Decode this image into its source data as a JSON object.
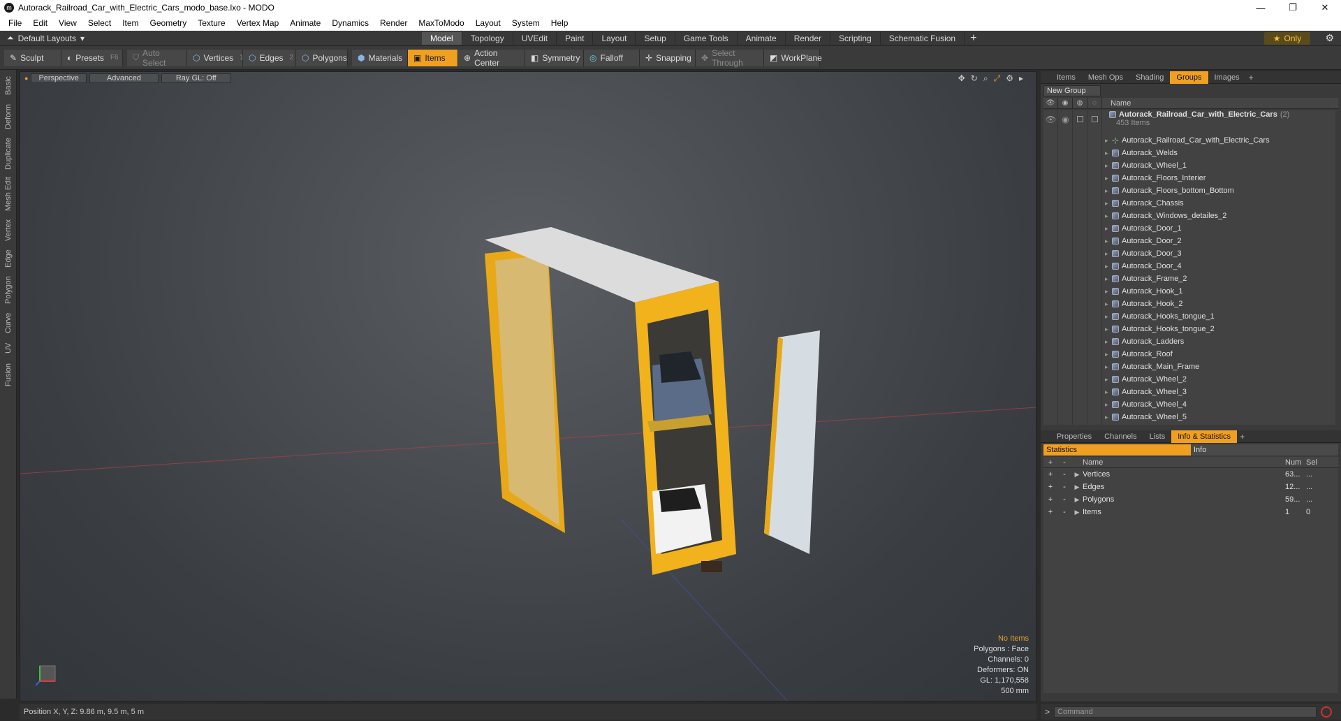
{
  "window": {
    "title": "Autorack_Railroad_Car_with_Electric_Cars_modo_base.lxo - MODO"
  },
  "menu": [
    "File",
    "Edit",
    "View",
    "Select",
    "Item",
    "Geometry",
    "Texture",
    "Vertex Map",
    "Animate",
    "Dynamics",
    "Render",
    "MaxToModo",
    "Layout",
    "System",
    "Help"
  ],
  "layout": {
    "preset": "Default Layouts",
    "tabs": [
      "Model",
      "Topology",
      "UVEdit",
      "Paint",
      "Layout",
      "Setup",
      "Game Tools",
      "Animate",
      "Render",
      "Scripting",
      "Schematic Fusion"
    ],
    "active_tab": "Model",
    "only_label": "Only"
  },
  "toolbar": {
    "sculpt": "Sculpt",
    "presets": "Presets",
    "presets_key": "F6",
    "auto_select": "Auto Select",
    "vertices": "Vertices",
    "vertices_num": "1",
    "edges": "Edges",
    "edges_num": "2",
    "polygons": "Polygons",
    "materials": "Materials",
    "items": "Items",
    "action_center": "Action Center",
    "symmetry": "Symmetry",
    "falloff": "Falloff",
    "snapping": "Snapping",
    "select_through": "Select Through",
    "workplane": "WorkPlane"
  },
  "left_tabs": [
    "Basic",
    "Deform",
    "Duplicate",
    "Mesh Edit",
    "Vertex",
    "Edge",
    "Polygon",
    "Curve",
    "UV",
    "Fusion"
  ],
  "viewport": {
    "view_mode": "Perspective",
    "shading": "Advanced",
    "raygl": "Ray GL: Off",
    "info": {
      "no_items": "No Items",
      "polygons": "Polygons : Face",
      "channels": "Channels: 0",
      "deformers": "Deformers: ON",
      "gl": "GL: 1,170,558",
      "scale": "500 mm"
    }
  },
  "items_panel": {
    "tabs": [
      "Items",
      "Mesh Ops",
      "Shading",
      "Groups",
      "Images"
    ],
    "active_tab": "Groups",
    "new_group": "New Group",
    "name_header": "Name",
    "group_name": "Autorack_Railroad_Car_with_Electric_Cars",
    "group_count": "(2)",
    "group_items": "453 Items",
    "items": [
      "Autorack_Railroad_Car_with_Electric_Cars",
      "Autorack_Welds",
      "Autorack_Wheel_1",
      "Autorack_Floors_Interier",
      "Autorack_Floors_bottom_Bottom",
      "Autorack_Chassis",
      "Autorack_Windows_detailes_2",
      "Autorack_Door_1",
      "Autorack_Door_2",
      "Autorack_Door_3",
      "Autorack_Door_4",
      "Autorack_Frame_2",
      "Autorack_Hook_1",
      "Autorack_Hook_2",
      "Autorack_Hooks_tongue_1",
      "Autorack_Hooks_tongue_2",
      "Autorack_Ladders",
      "Autorack_Roof",
      "Autorack_Main_Frame",
      "Autorack_Wheel_2",
      "Autorack_Wheel_3",
      "Autorack_Wheel_4",
      "Autorack_Wheel_5"
    ]
  },
  "stats_panel": {
    "tabs": [
      "Properties",
      "Channels",
      "Lists",
      "Info & Statistics"
    ],
    "active_tab": "Info & Statistics",
    "subtabs": [
      "Statistics",
      "Info"
    ],
    "headers": {
      "name": "Name",
      "num": "Num",
      "sel": "Sel"
    },
    "rows": [
      {
        "name": "Vertices",
        "num": "63...",
        "sel": "..."
      },
      {
        "name": "Edges",
        "num": "12...",
        "sel": "..."
      },
      {
        "name": "Polygons",
        "num": "59...",
        "sel": "..."
      },
      {
        "name": "Items",
        "num": "1",
        "sel": "0"
      }
    ]
  },
  "status": {
    "position": "Position X, Y, Z:  9.86 m, 9.5 m, 5 m"
  },
  "command": {
    "placeholder": "Command"
  },
  "colors": {
    "accent": "#f0a020",
    "railcar": "#f2b21c"
  }
}
